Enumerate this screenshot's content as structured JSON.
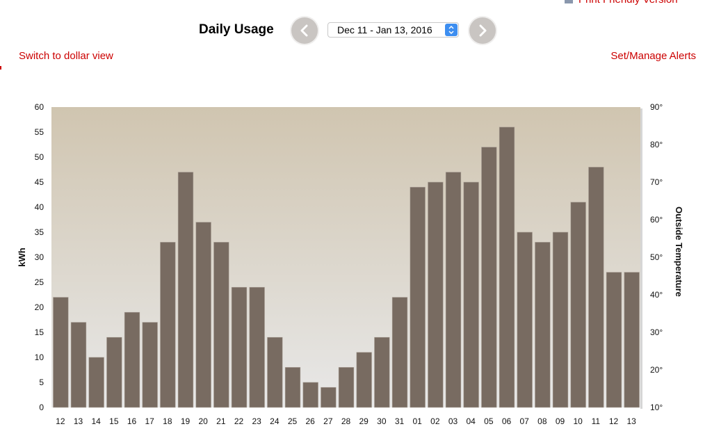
{
  "print_link": {
    "label": "Print Friendly Version",
    "icon": "print-icon"
  },
  "header": {
    "title": "Daily Usage",
    "prev_icon": "chevron-left-icon",
    "next_icon": "chevron-right-icon",
    "range_selected": "Dec 11 - Jan 13, 2016"
  },
  "links": {
    "dollar_view": "Switch to dollar view",
    "alerts": "Set/Manage Alerts"
  },
  "colors": {
    "link": "#cc0000",
    "bar": "#786b61",
    "bar_edge": "#a89e95",
    "plot_top": "#d0c5b0",
    "plot_bottom": "#e8e8e8",
    "select_accent": "#3d8ef0"
  },
  "chart_data": {
    "type": "bar",
    "title": "Daily Usage",
    "xlabel": "",
    "ylabel": "kWh",
    "y2label": "Outside Temperature",
    "ylim": [
      0,
      60
    ],
    "yticks": [
      "0",
      "5",
      "10",
      "15",
      "20",
      "25",
      "30",
      "35",
      "40",
      "45",
      "50",
      "55",
      "60"
    ],
    "y2lim": [
      10,
      90
    ],
    "y2ticks": [
      "10°",
      "20°",
      "30°",
      "40°",
      "50°",
      "60°",
      "70°",
      "80°",
      "90°"
    ],
    "grid": false,
    "categories": [
      "12",
      "13",
      "14",
      "15",
      "16",
      "17",
      "18",
      "19",
      "20",
      "21",
      "22",
      "23",
      "24",
      "25",
      "26",
      "27",
      "28",
      "29",
      "30",
      "31",
      "01",
      "02",
      "03",
      "04",
      "05",
      "06",
      "07",
      "08",
      "09",
      "10",
      "11",
      "12",
      "13"
    ],
    "series": [
      {
        "name": "kWh",
        "values": [
          22,
          17,
          10,
          14,
          19,
          17,
          33,
          47,
          37,
          33,
          24,
          24,
          14,
          8,
          5,
          4,
          8,
          11,
          14,
          22,
          44,
          45,
          47,
          45,
          52,
          56,
          35,
          33,
          35,
          41,
          48,
          27,
          27
        ]
      }
    ]
  }
}
